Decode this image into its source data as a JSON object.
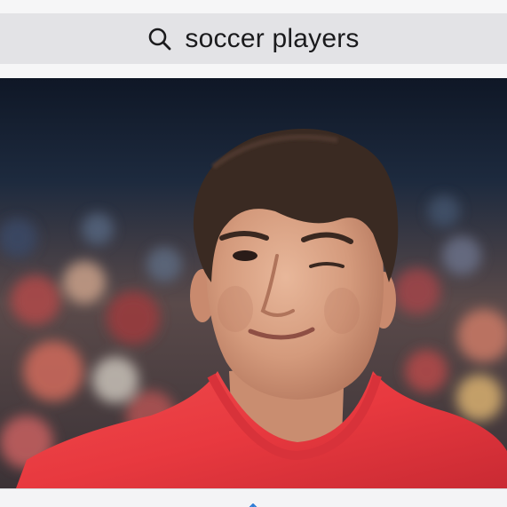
{
  "search": {
    "query": "soccer players",
    "icon": "magnifying-glass"
  },
  "image": {
    "description_icon": "photo",
    "subject": "person-photo"
  },
  "toolbar": {
    "icon": "share-up-arrow"
  },
  "colors": {
    "search_bar_bg": "#e3e3e6",
    "page_bg": "#f4f4f6",
    "jersey": "#e8393f",
    "accent_icon": "#2f7dd6"
  }
}
